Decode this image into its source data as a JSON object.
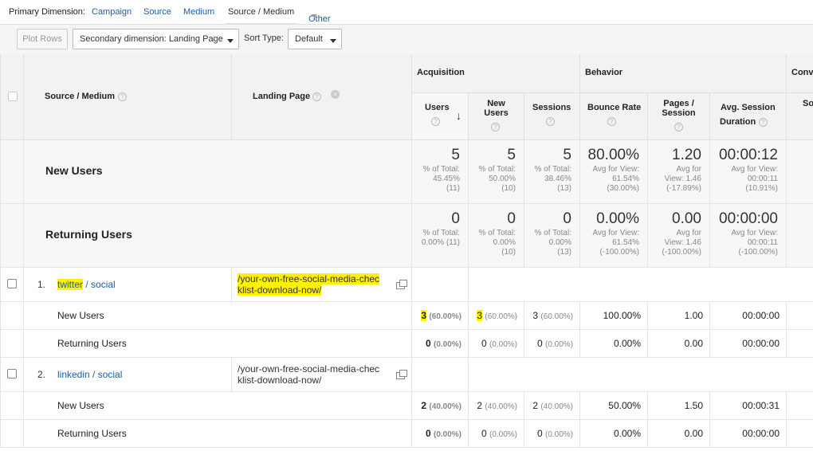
{
  "dimension_bar": {
    "label": "Primary Dimension:",
    "options": [
      "Campaign",
      "Source",
      "Medium",
      "Source / Medium",
      "Other"
    ],
    "active": "Source / Medium"
  },
  "toolbar": {
    "plot_rows": "Plot Rows",
    "secondary_dimension": "Secondary dimension: Landing Page",
    "sort_type_label": "Sort Type:",
    "sort_type_value": "Default"
  },
  "headers": {
    "source_medium": "Source / Medium",
    "landing_page": "Landing Page",
    "acquisition": "Acquisition",
    "behavior": "Behavior",
    "conversions": "Conve",
    "users": "Users",
    "new_users_l1": "New",
    "new_users_l2": "Users",
    "sessions": "Sessions",
    "bounce_rate": "Bounce Rate",
    "pages_session_l1": "Pages /",
    "pages_session_l2": "Session",
    "avg_session_l1": "Avg. Session",
    "avg_session_l2": "Duration",
    "so": "So"
  },
  "segments": [
    {
      "label": "New Users",
      "users": {
        "value": "5",
        "l1": "% of Total:",
        "l2": "45.45%",
        "l3": "(11)"
      },
      "new_users": {
        "value": "5",
        "l1": "% of Total:",
        "l2": "50.00%",
        "l3": "(10)"
      },
      "sessions": {
        "value": "5",
        "l1": "% of Total:",
        "l2": "38.46%",
        "l3": "(13)"
      },
      "bounce_rate": {
        "value": "80.00%",
        "l1": "Avg for View:",
        "l2": "61.54%",
        "l3": "(30.00%)"
      },
      "pages_session": {
        "value": "1.20",
        "l1": "Avg for",
        "l2": "View: 1.46",
        "l3": "(-17.89%)"
      },
      "avg_duration": {
        "value": "00:00:12",
        "l1": "Avg for View:",
        "l2": "00:00:11",
        "l3": "(10.91%)"
      }
    },
    {
      "label": "Returning Users",
      "users": {
        "value": "0",
        "l1": "% of Total:",
        "l2": "0.00% (11)",
        "l3": ""
      },
      "new_users": {
        "value": "0",
        "l1": "% of Total:",
        "l2": "0.00%",
        "l3": "(10)"
      },
      "sessions": {
        "value": "0",
        "l1": "% of Total:",
        "l2": "0.00%",
        "l3": "(13)"
      },
      "bounce_rate": {
        "value": "0.00%",
        "l1": "Avg for View:",
        "l2": "61.54%",
        "l3": "(-100.00%)"
      },
      "pages_session": {
        "value": "0.00",
        "l1": "Avg for",
        "l2": "View: 1.46",
        "l3": "(-100.00%)"
      },
      "avg_duration": {
        "value": "00:00:00",
        "l1": "Avg for View:",
        "l2": "00:00:11",
        "l3": "(-100.00%)"
      }
    }
  ],
  "rows": [
    {
      "index": "1.",
      "source": "twitter",
      "sep": " / ",
      "medium": "social",
      "landing_l1": "/your-own-free-social-media-chec",
      "landing_l2": "klist-download-now/",
      "sub": [
        {
          "label": "New Users",
          "users": "3",
          "users_pct": "(60.00%)",
          "new_users": "3",
          "new_users_pct": "(60.00%)",
          "sessions": "3",
          "sessions_pct": "(60.00%)",
          "bounce": "100.00%",
          "pages": "1.00",
          "duration": "00:00:00"
        },
        {
          "label": "Returning Users",
          "users": "0",
          "users_pct": "(0.00%)",
          "new_users": "0",
          "new_users_pct": "(0.00%)",
          "sessions": "0",
          "sessions_pct": "(0.00%)",
          "bounce": "0.00%",
          "pages": "0.00",
          "duration": "00:00:00"
        }
      ]
    },
    {
      "index": "2.",
      "source": "linkedin",
      "sep": " / ",
      "medium": "social",
      "landing_l1": "/your-own-free-social-media-chec",
      "landing_l2": "klist-download-now/",
      "sub": [
        {
          "label": "New Users",
          "users": "2",
          "users_pct": "(40.00%)",
          "new_users": "2",
          "new_users_pct": "(40.00%)",
          "sessions": "2",
          "sessions_pct": "(40.00%)",
          "bounce": "50.00%",
          "pages": "1.50",
          "duration": "00:00:31"
        },
        {
          "label": "Returning Users",
          "users": "0",
          "users_pct": "(0.00%)",
          "new_users": "0",
          "new_users_pct": "(0.00%)",
          "sessions": "0",
          "sessions_pct": "(0.00%)",
          "bounce": "0.00%",
          "pages": "0.00",
          "duration": "00:00:00"
        }
      ]
    }
  ],
  "colors": {
    "link": "#1a5ea8",
    "highlight": "#fff200"
  }
}
